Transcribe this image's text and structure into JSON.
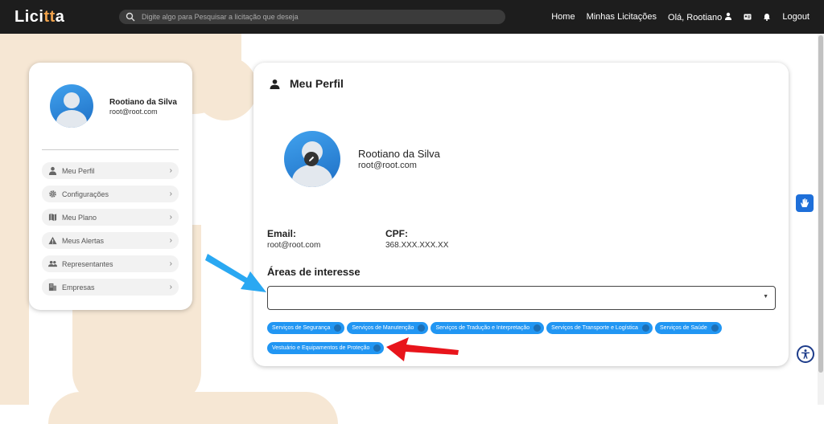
{
  "app": {
    "logo_prefix": "Lici",
    "logo_accent": "tt",
    "logo_suffix": "a"
  },
  "search": {
    "placeholder": "Digite algo para Pesquisar a licitação que deseja"
  },
  "nav": {
    "home": "Home",
    "my_bids": "Minhas Licitações",
    "greeting": "Olá, Rootiano",
    "logout": "Logout"
  },
  "sidebar": {
    "name": "Rootiano da Silva",
    "email": "root@root.com",
    "items": [
      {
        "label": "Meu Perfil",
        "icon": "user-icon"
      },
      {
        "label": "Configurações",
        "icon": "gear-icon"
      },
      {
        "label": "Meu Plano",
        "icon": "map-icon"
      },
      {
        "label": "Meus Alertas",
        "icon": "warning-icon"
      },
      {
        "label": "Representantes",
        "icon": "users-icon"
      },
      {
        "label": "Empresas",
        "icon": "building-icon"
      }
    ]
  },
  "profile": {
    "title": "Meu Perfil",
    "name": "Rootiano da Silva",
    "email": "root@root.com",
    "email_label": "Email:",
    "email_value": "root@root.com",
    "cpf_label": "CPF:",
    "cpf_value": "368.XXX.XXX.XX",
    "areas_title": "Áreas de interesse",
    "tags": [
      "Serviços de Segurança",
      "Serviços de Manutenção",
      "Serviços de Tradução e Interpretação",
      "Serviços de Transporte e Logística",
      "Serviços de Saúde",
      "Vestuário e Equipamentos de Proteção"
    ]
  },
  "colors": {
    "accent": "#2196f3",
    "topbar": "#1d1d1d",
    "arrow_blue": "#2aa8f2",
    "arrow_red": "#e8141b"
  }
}
